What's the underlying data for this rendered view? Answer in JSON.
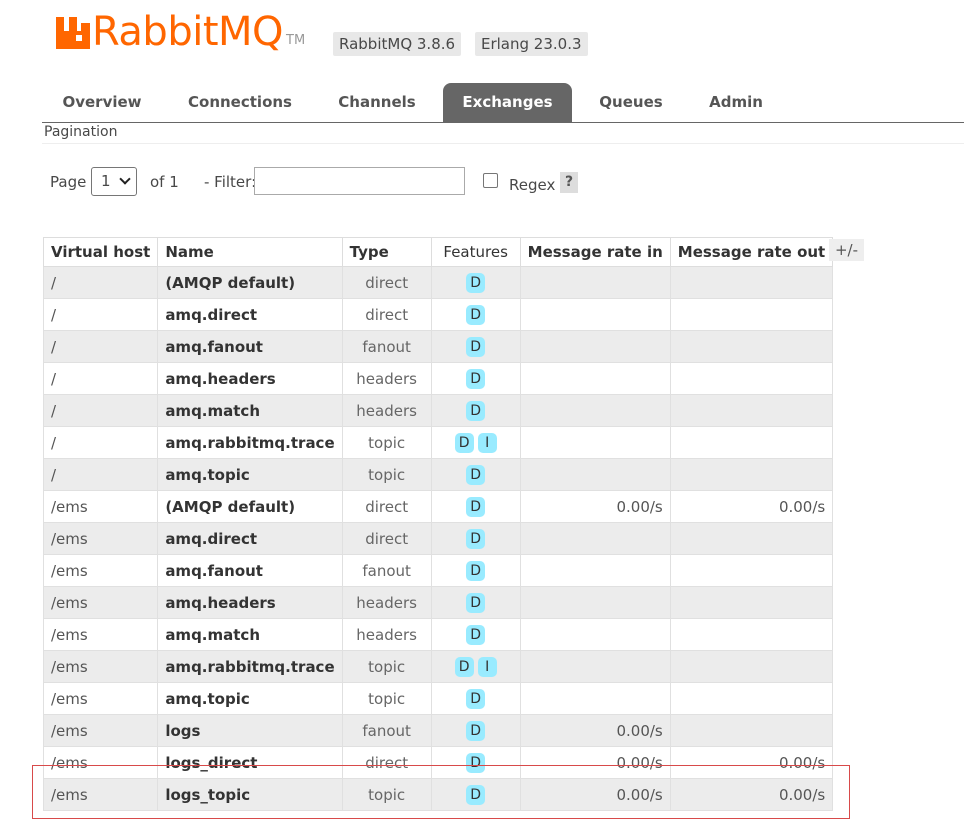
{
  "header": {
    "logo_text": "RabbitMQ",
    "logo_tm": "TM",
    "version": "RabbitMQ 3.8.6",
    "erlang": "Erlang 23.0.3",
    "brand_color": "#ff6600"
  },
  "tabs": [
    {
      "label": "Overview"
    },
    {
      "label": "Connections"
    },
    {
      "label": "Channels"
    },
    {
      "label": "Exchanges",
      "active": true
    },
    {
      "label": "Queues"
    },
    {
      "label": "Admin"
    }
  ],
  "pagination": {
    "title": "Pagination",
    "page_label": "Page",
    "page_value": "1",
    "of_label": "of 1",
    "filter_label": "- Filter:",
    "filter_value": "",
    "regex_label": "Regex",
    "help": "?"
  },
  "table": {
    "columns": [
      "Virtual host",
      "Name",
      "Type",
      "Features",
      "Message rate in",
      "Message rate out"
    ],
    "toggle_columns": "+/-",
    "rows": [
      {
        "vhost": "/",
        "name": "(AMQP default)",
        "type": "direct",
        "features": [
          "D"
        ],
        "rate_in": "",
        "rate_out": ""
      },
      {
        "vhost": "/",
        "name": "amq.direct",
        "type": "direct",
        "features": [
          "D"
        ],
        "rate_in": "",
        "rate_out": ""
      },
      {
        "vhost": "/",
        "name": "amq.fanout",
        "type": "fanout",
        "features": [
          "D"
        ],
        "rate_in": "",
        "rate_out": ""
      },
      {
        "vhost": "/",
        "name": "amq.headers",
        "type": "headers",
        "features": [
          "D"
        ],
        "rate_in": "",
        "rate_out": ""
      },
      {
        "vhost": "/",
        "name": "amq.match",
        "type": "headers",
        "features": [
          "D"
        ],
        "rate_in": "",
        "rate_out": ""
      },
      {
        "vhost": "/",
        "name": "amq.rabbitmq.trace",
        "type": "topic",
        "features": [
          "D",
          "I"
        ],
        "rate_in": "",
        "rate_out": ""
      },
      {
        "vhost": "/",
        "name": "amq.topic",
        "type": "topic",
        "features": [
          "D"
        ],
        "rate_in": "",
        "rate_out": ""
      },
      {
        "vhost": "/ems",
        "name": "(AMQP default)",
        "type": "direct",
        "features": [
          "D"
        ],
        "rate_in": "0.00/s",
        "rate_out": "0.00/s"
      },
      {
        "vhost": "/ems",
        "name": "amq.direct",
        "type": "direct",
        "features": [
          "D"
        ],
        "rate_in": "",
        "rate_out": ""
      },
      {
        "vhost": "/ems",
        "name": "amq.fanout",
        "type": "fanout",
        "features": [
          "D"
        ],
        "rate_in": "",
        "rate_out": ""
      },
      {
        "vhost": "/ems",
        "name": "amq.headers",
        "type": "headers",
        "features": [
          "D"
        ],
        "rate_in": "",
        "rate_out": ""
      },
      {
        "vhost": "/ems",
        "name": "amq.match",
        "type": "headers",
        "features": [
          "D"
        ],
        "rate_in": "",
        "rate_out": ""
      },
      {
        "vhost": "/ems",
        "name": "amq.rabbitmq.trace",
        "type": "topic",
        "features": [
          "D",
          "I"
        ],
        "rate_in": "",
        "rate_out": ""
      },
      {
        "vhost": "/ems",
        "name": "amq.topic",
        "type": "topic",
        "features": [
          "D"
        ],
        "rate_in": "",
        "rate_out": ""
      },
      {
        "vhost": "/ems",
        "name": "logs",
        "type": "fanout",
        "features": [
          "D"
        ],
        "rate_in": "0.00/s",
        "rate_out": ""
      },
      {
        "vhost": "/ems",
        "name": "logs_direct",
        "type": "direct",
        "features": [
          "D"
        ],
        "rate_in": "0.00/s",
        "rate_out": "0.00/s"
      },
      {
        "vhost": "/ems",
        "name": "logs_topic",
        "type": "topic",
        "features": [
          "D"
        ],
        "rate_in": "0.00/s",
        "rate_out": "0.00/s"
      }
    ]
  }
}
